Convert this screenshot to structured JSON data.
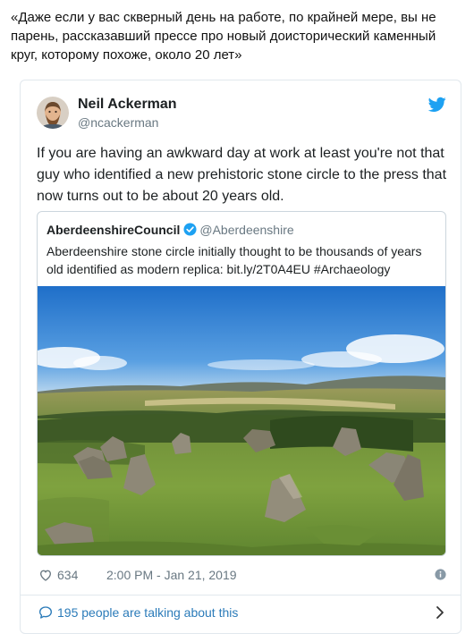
{
  "caption": "«Даже если у вас скверный день на работе, по крайней мере, вы не парень, рассказавший прессе про новый доисторический каменный круг, которому похоже, около 20 лет»",
  "tweet": {
    "author_name": "Neil Ackerman",
    "author_handle": "@ncackerman",
    "text": "If you are having an awkward day at work at least you're not that guy who identified a new prehistoric stone circle to the press that now turns out to be about 20 years old.",
    "likes": "634",
    "timestamp": "2:00 PM - Jan 21, 2019",
    "conversation_label": "195 people are talking about this"
  },
  "quoted_tweet": {
    "author_name": "AberdeenshireCouncil",
    "author_handle": "@Aberdeenshire",
    "text": "Aberdeenshire stone circle initially thought to be thousands of years old identified as modern replica: bit.ly/2T0A4EU #Archaeology"
  },
  "colors": {
    "twitter_blue": "#1da1f2",
    "link_blue": "#2b7bb9",
    "muted_text": "#697882",
    "border": "#e1e8ed"
  },
  "icons": [
    "twitter-bird-icon",
    "verified-badge-icon",
    "heart-icon",
    "info-icon",
    "speech-bubble-icon",
    "chevron-right-icon"
  ]
}
